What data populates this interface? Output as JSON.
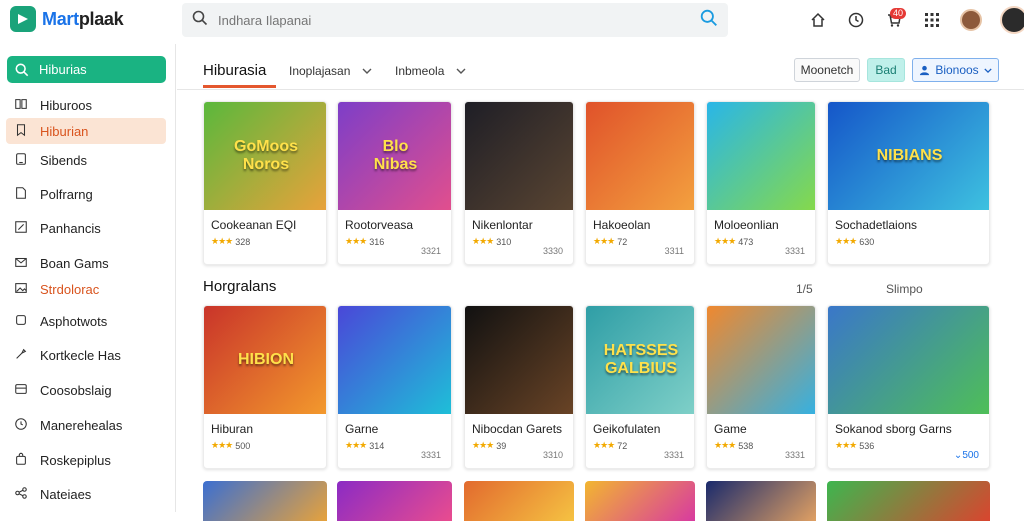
{
  "app": {
    "logo_text": "Martplaak",
    "logo_accent": "Mart",
    "logo_rest": "plaak"
  },
  "search": {
    "placeholder": "Indhara Ilapanai"
  },
  "header_icons": [
    "home-icon",
    "clock-icon",
    "cart-icon",
    "grid-icon",
    "avatar",
    "profile-avatar"
  ],
  "cart_badge": "40",
  "sidebar": {
    "search_label": "Hiburias",
    "items": [
      {
        "label": "Hiburoos",
        "icon": "book-icon"
      },
      {
        "label": "Hiburian",
        "icon": "bookmark-icon",
        "active": true
      },
      {
        "label": "Sibends",
        "icon": "tablet-icon"
      },
      {
        "label": "Polfrarng",
        "icon": "document-icon"
      },
      {
        "label": "Panhancis",
        "icon": "edit-icon"
      },
      {
        "label": "Boan Gams",
        "icon": "mail-icon"
      },
      {
        "label": "Strdolorac",
        "icon": "image-icon",
        "red": true
      },
      {
        "label": "Asphotwots",
        "icon": "box-icon"
      },
      {
        "label": "Kortkecle Has",
        "icon": "tool-icon"
      },
      {
        "label": "Coosobslaig",
        "icon": "panel-icon"
      },
      {
        "label": "Manerehealas",
        "icon": "clock-icon",
        "red_part": true
      },
      {
        "label": "Roskepiplus",
        "icon": "shopping-icon"
      },
      {
        "label": "Nateiaes",
        "icon": "share-icon"
      }
    ]
  },
  "tabs": {
    "title": "Hiburasia",
    "dropdown1": "Inoplajasan",
    "dropdown2": "Inbmeola",
    "btn_outline": "Moonetch",
    "btn_teal": "Bad",
    "btn_blue": "Bionoos"
  },
  "row1": [
    {
      "title": "Cookeanan EQI",
      "rating": "328",
      "price": "",
      "art": "GoMoos\nNoros",
      "c1": "#5ab83c",
      "c2": "#e9a23b"
    },
    {
      "title": "Rootorveasa",
      "rating": "316",
      "price": "3321",
      "art": "Blo\nNibas",
      "c1": "#7d3ec8",
      "c2": "#e24f8d"
    },
    {
      "title": "Nikenlontar",
      "rating": "310",
      "price": "3330",
      "art": "",
      "c1": "#1e1e26",
      "c2": "#5a4532"
    },
    {
      "title": "Hakoeolan",
      "rating": "72",
      "price": "3311",
      "art": "",
      "c1": "#e0522a",
      "c2": "#f3a13f"
    },
    {
      "title": "Moloeonlian",
      "rating": "473",
      "price": "3331",
      "art": "",
      "c1": "#29b6e8",
      "c2": "#86d94a"
    },
    {
      "title": "Sochadetlaions",
      "rating": "630",
      "price": "",
      "art": "NIBIANS",
      "c1": "#1556c9",
      "c2": "#3ec2e0"
    }
  ],
  "section2": {
    "title": "Horgralans",
    "nav": "1/5",
    "link": "Slimpo"
  },
  "row2": [
    {
      "title": "Hiburan",
      "rating": "500",
      "price": "",
      "art": "HIBION",
      "c1": "#c9342a",
      "c2": "#f39a2d"
    },
    {
      "title": "Garne",
      "rating": "314",
      "price": "3331",
      "art": "",
      "c1": "#4a47d8",
      "c2": "#1ec0d8"
    },
    {
      "title": "Nibocdan Garets",
      "rating": "39",
      "price": "3310",
      "art": "",
      "c1": "#111111",
      "c2": "#6a4426"
    },
    {
      "title": "Geikofulaten",
      "rating": "72",
      "price": "3331",
      "art": "HATSSES\nGALBIUS",
      "c1": "#2f9ea6",
      "c2": "#7fd0c8"
    },
    {
      "title": "Game",
      "rating": "538",
      "price": "3331",
      "art": "",
      "c1": "#f0882e",
      "c2": "#34b1e2"
    },
    {
      "title": "Sokanod sborg Garns",
      "rating": "536",
      "price": "500",
      "art": "",
      "c1": "#3a77c9",
      "c2": "#4fbf57"
    }
  ],
  "row3_colors": [
    [
      "#3b6fd1",
      "#e6a23c"
    ],
    [
      "#8b2bc4",
      "#e94c8f"
    ],
    [
      "#e26a2e",
      "#f5c242"
    ],
    [
      "#f2b630",
      "#d83aa0"
    ],
    [
      "#1a2a6c",
      "#e0a063"
    ],
    [
      "#3db64f",
      "#d9452f"
    ]
  ]
}
